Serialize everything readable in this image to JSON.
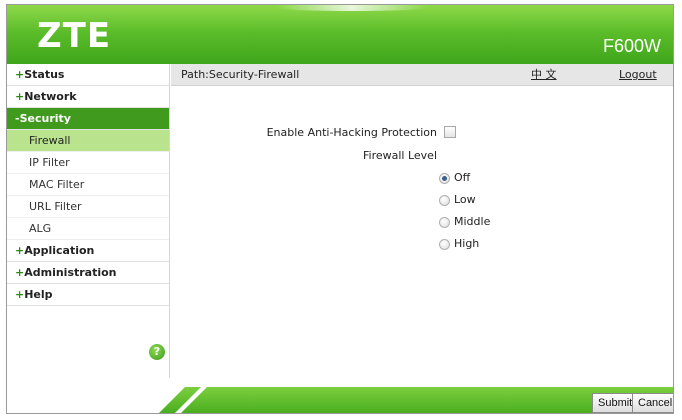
{
  "header": {
    "logo": "ZTE",
    "model": "F600W"
  },
  "sidebar": {
    "items": [
      {
        "type": "head",
        "prefix": "+",
        "label": "Status"
      },
      {
        "type": "head",
        "prefix": "+",
        "label": "Network"
      },
      {
        "type": "head",
        "prefix": "-",
        "label": "Security",
        "active": true
      },
      {
        "type": "sub",
        "label": "Firewall",
        "active": true
      },
      {
        "type": "sub",
        "label": "IP Filter"
      },
      {
        "type": "sub",
        "label": "MAC Filter"
      },
      {
        "type": "sub",
        "label": "URL Filter"
      },
      {
        "type": "sub",
        "label": "ALG"
      },
      {
        "type": "head",
        "prefix": "+",
        "label": "Application"
      },
      {
        "type": "head",
        "prefix": "+",
        "label": "Administration"
      },
      {
        "type": "head",
        "prefix": "+",
        "label": "Help"
      }
    ],
    "help_icon": {
      "icon": "help-icon",
      "glyph": "?"
    }
  },
  "pathbar": {
    "path": "Path:Security-Firewall",
    "language": "中 文",
    "logout": "Logout"
  },
  "form": {
    "anti_hacking_label": "Enable Anti-Hacking Protection",
    "anti_hacking_checked": false,
    "firewall_level_label": "Firewall Level",
    "levels": [
      {
        "label": "Off",
        "checked": true
      },
      {
        "label": "Low",
        "checked": false
      },
      {
        "label": "Middle",
        "checked": false
      },
      {
        "label": "High",
        "checked": false
      }
    ]
  },
  "footer": {
    "submit_label": "Submit",
    "cancel_label": "Cancel"
  },
  "colors": {
    "brand_green": "#4aae1f",
    "active_menu": "#3f9a1e",
    "active_submenu": "#b9e48d"
  }
}
